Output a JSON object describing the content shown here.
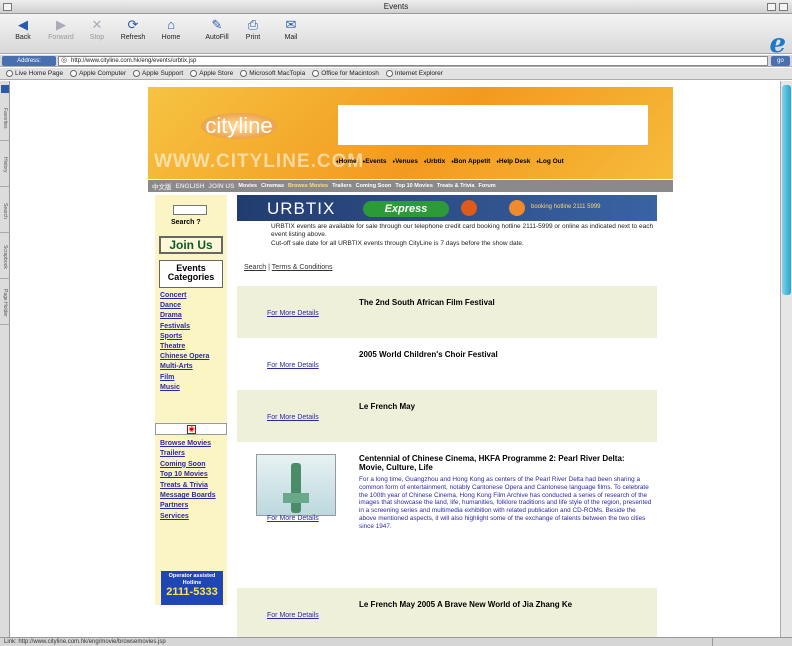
{
  "window": {
    "title": "Events"
  },
  "toolbar": {
    "back": "Back",
    "forward": "Forward",
    "stop": "Stop",
    "refresh": "Refresh",
    "home": "Home",
    "autofill": "AutoFill",
    "print": "Print",
    "mail": "Mail"
  },
  "address": {
    "label": "Address:",
    "url": "http://www.cityline.com.hk/eng/events/urbtix.jsp",
    "go": "go"
  },
  "favorites": [
    "Live Home Page",
    "Apple Computer",
    "Apple Support",
    "Apple Store",
    "Microsoft MacTopia",
    "Office for Macintosh",
    "Internet Explorer"
  ],
  "sidebar_tabs": [
    "Favorites",
    "History",
    "Search",
    "Scrapbook",
    "Page Holder"
  ],
  "status": {
    "text": "Link: http://www.cityline.com.hk/eng/movie/browsemovies.jsp"
  },
  "site": {
    "logo": "cityline",
    "watermark": "WWW.CITYLINE.COM",
    "topnav": [
      "Home",
      "Events",
      "Venues",
      "Urbtix",
      "Bon Appetit",
      "Help Desk",
      "Log Out"
    ],
    "lang_zh": "中文版",
    "lang_en": "ENGLISH",
    "join_us_bar": "JOIN US",
    "subnav": [
      "Movies",
      "Cinemas",
      "Browse Movies",
      "Trailers",
      "Coming Soon",
      "Top 10 Movies",
      "Treats & Trivia",
      "Forum"
    ],
    "subnav_current": "Browse Movies"
  },
  "leftnav": {
    "search_label": "Search",
    "join_label": "Join Us",
    "categories_title": "Events Categories",
    "categories": [
      "Concert",
      "Dance",
      "Drama",
      "Festivals",
      "Sports",
      "Theatre",
      "Chinese Opera",
      "Multi-Arts",
      "Film",
      "Music"
    ],
    "links": [
      "Browse Movies",
      "Trailers",
      "Coming Soon",
      "Top 10 Movies",
      "Treats & Trivia",
      "Message Boards",
      "Partners",
      "Services"
    ],
    "hotline_label": "Operator assisted Hotline",
    "hotline_number": "2111-5333"
  },
  "urbtix": {
    "brand": "URBTIX",
    "express": "Express",
    "booking": "booking hotline 2111 5999",
    "notice_1": "URBTIX events are available for sale through our telephone credit card booking hotline 2111-5999 or online as indicated next to each event listing above.",
    "notice_2": "Cut-off sale date for all URBTIX events through CityLine is 7 days before the show date."
  },
  "search_terms": {
    "search": "Search",
    "sep": "|",
    "terms": "Terms & Conditions"
  },
  "events": [
    {
      "title": "The 2nd South African Film Festival",
      "more": "For More Details"
    },
    {
      "title": "2005 World Children's Choir Festival",
      "more": "For More Details"
    },
    {
      "title": "Le French May",
      "more": "For More Details"
    },
    {
      "title": "Centennial of Chinese Cinema, HKFA Programme 2: Pearl River Delta: Movie, Culture, Life",
      "more": "For More Details",
      "desc": "For a long time, Guangzhou and Hong Kong as centers of the Pearl River Delta had been sharing a common form of entertainment, notably Cantonese Opera and Cantonese language films. To celebrate the 100th year of Chinese Cinema, Hong Kong Film Archive has conducted a series of research of the images that showcase the land, life, humanities, folklore traditions and life style of the region, presented in a screening series and multimedia exhibition with related publication and CD-ROMs. Beside the above mentioned aspects, it will also highlight some of the exchange of talents between the two cities since 1947."
    },
    {
      "title": "Le French May 2005 A Brave New World of Jia Zhang Ke",
      "more": "For More Details"
    }
  ]
}
